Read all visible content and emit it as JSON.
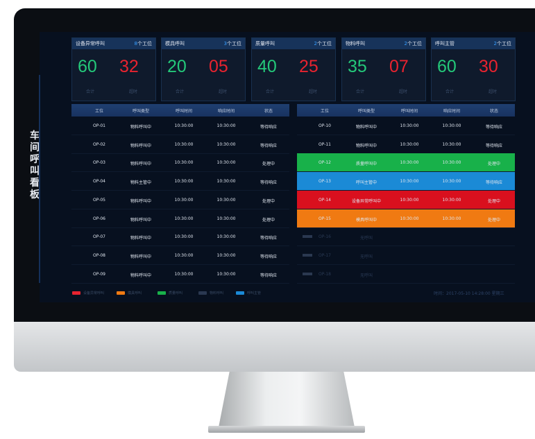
{
  "side_title": "车间呼叫看板",
  "cards": [
    {
      "title": "设备异常呼叫",
      "count_num": "8",
      "count_unit": "个工位",
      "total": "60",
      "overtime": "32",
      "total_label": "合计",
      "overtime_label": "超时"
    },
    {
      "title": "模具呼叫",
      "count_num": "3",
      "count_unit": "个工位",
      "total": "20",
      "overtime": "05",
      "total_label": "合计",
      "overtime_label": "超时"
    },
    {
      "title": "质量呼叫",
      "count_num": "2",
      "count_unit": "个工位",
      "total": "40",
      "overtime": "25",
      "total_label": "合计",
      "overtime_label": "超时"
    },
    {
      "title": "物料呼叫",
      "count_num": "2",
      "count_unit": "个工位",
      "total": "35",
      "overtime": "07",
      "total_label": "合计",
      "overtime_label": "超时"
    },
    {
      "title": "呼叫主管",
      "count_num": "2",
      "count_unit": "个工位",
      "total": "60",
      "overtime": "30",
      "total_label": "合计",
      "overtime_label": "超时"
    }
  ],
  "table_headers": [
    "工位",
    "呼叫类型",
    "呼叫时间",
    "响应时间",
    "状态"
  ],
  "left_rows": [
    [
      "OP-01",
      "物料呼叫中",
      "10:30:00",
      "10:30:00",
      "等待响应"
    ],
    [
      "OP-02",
      "物料呼叫中",
      "10:30:00",
      "10:30:00",
      "等待响应"
    ],
    [
      "OP-03",
      "物料呼叫中",
      "10:30:00",
      "10:30:00",
      "处理中"
    ],
    [
      "OP-04",
      "物料主管中",
      "10:30:00",
      "10:30:00",
      "等待响应"
    ],
    [
      "OP-05",
      "物料呼叫中",
      "10:30:00",
      "10:30:00",
      "处理中"
    ],
    [
      "OP-06",
      "物料呼叫中",
      "10:30:00",
      "10:30:00",
      "处理中"
    ],
    [
      "OP-07",
      "物料呼叫中",
      "10:30:00",
      "10:30:00",
      "等待响应"
    ],
    [
      "OP-08",
      "物料呼叫中",
      "10:30:00",
      "10:30:00",
      "等待响应"
    ],
    [
      "OP-09",
      "物料呼叫中",
      "10:30:00",
      "10:30:00",
      "等待响应"
    ]
  ],
  "right_rows": [
    [
      "OP-10",
      "物料呼叫中",
      "10:30:00",
      "10:30:00",
      "等待响应"
    ],
    [
      "OP-11",
      "物料呼叫中",
      "10:30:00",
      "10:30:00",
      "等待响应"
    ],
    [
      "OP-12",
      "质量呼叫中",
      "10:30:00",
      "10:30:00",
      "处理中"
    ],
    [
      "OP-13",
      "呼叫主管中",
      "10:30:00",
      "10:30:00",
      "等待响应"
    ],
    [
      "OP-14",
      "设备异常呼叫中",
      "10:30:00",
      "10:30:00",
      "处理中"
    ],
    [
      "OP-15",
      "模具呼叫中",
      "10:30:00",
      "10:30:00",
      "处理中"
    ],
    [
      "OP-16",
      "无呼叫",
      "",
      "",
      ""
    ],
    [
      "OP-17",
      "无呼叫",
      "",
      "",
      ""
    ],
    [
      "OP-18",
      "无呼叫",
      "",
      "",
      ""
    ]
  ],
  "right_row_colors": [
    "",
    "",
    "green",
    "blue",
    "red",
    "orange",
    "dim",
    "dim",
    "dim"
  ],
  "legend": [
    {
      "label": "设备异常呼叫",
      "color": "#e8232f"
    },
    {
      "label": "模具呼叫",
      "color": "#f07a12"
    },
    {
      "label": "质量呼叫",
      "color": "#18b14a"
    },
    {
      "label": "物料呼叫",
      "color": "#2a3850"
    },
    {
      "label": "呼叫主管",
      "color": "#1b8ad6"
    }
  ],
  "footer_time": "时间：2017-05-10 14:28:00 星期三"
}
